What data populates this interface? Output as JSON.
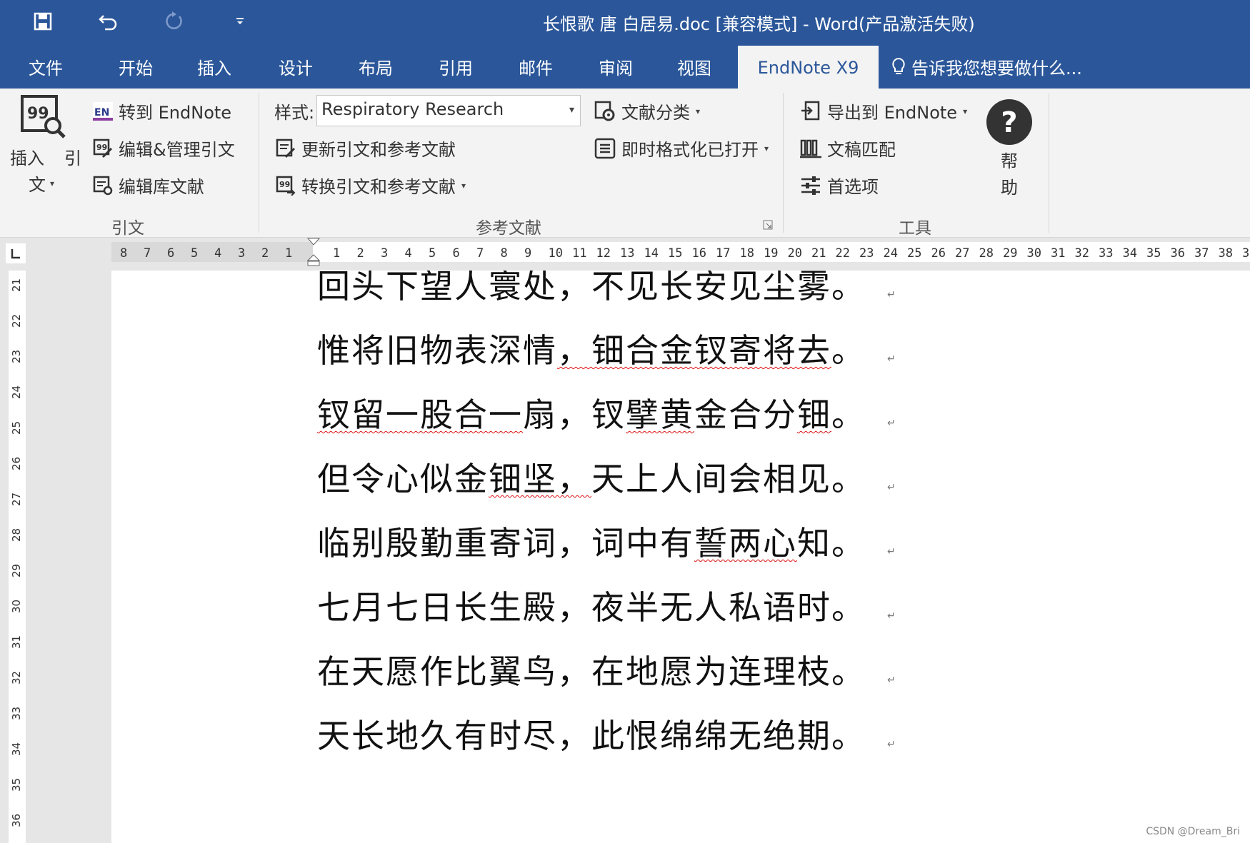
{
  "titlebar": {
    "title": "长恨歌 唐 白居易.doc [兼容模式] - Word(产品激活失败)",
    "quick_access": [
      "save-icon",
      "undo-icon",
      "redo-icon",
      "customize-icon"
    ]
  },
  "tabs": {
    "items": [
      "文件",
      "开始",
      "插入",
      "设计",
      "布局",
      "引用",
      "邮件",
      "审阅",
      "视图"
    ],
    "active": "EndNote X9",
    "tell_me": "告诉我您想要做什么..."
  },
  "ribbon": {
    "citations": {
      "insert_label": "插入",
      "insert_label2": "引",
      "insert_label3": "文",
      "goto_endnote": "转到 EndNote",
      "edit_manage": "编辑&管理引文",
      "edit_library": "编辑库文献",
      "group": "引文"
    },
    "bibliography": {
      "style_label": "样式:",
      "style_value": "Respiratory Research",
      "update": "更新引文和参考文献",
      "convert": "转换引文和参考文献",
      "categorize": "文献分类",
      "instant_format": "即时格式化已打开",
      "group": "参考文献"
    },
    "tools": {
      "export": "导出到 EndNote",
      "manuscript": "文稿匹配",
      "preferences": "首选项",
      "help_1": "帮",
      "help_2": "助",
      "group": "工具"
    }
  },
  "ruler": {
    "left_ticks": [
      "8",
      "7",
      "6",
      "5",
      "4",
      "3",
      "2",
      "1"
    ],
    "right_ticks": [
      "1",
      "2",
      "3",
      "4",
      "5",
      "6",
      "7",
      "8",
      "9",
      "10",
      "11",
      "12",
      "13",
      "14",
      "15",
      "16",
      "17",
      "18",
      "19",
      "20",
      "21",
      "22",
      "23",
      "24",
      "25",
      "26",
      "27",
      "28",
      "29",
      "30",
      "31",
      "32",
      "33",
      "34",
      "35",
      "36",
      "37",
      "38",
      "3"
    ],
    "vertical_ticks": [
      "21",
      "22",
      "23",
      "24",
      "25",
      "26",
      "27",
      "28",
      "29",
      "30",
      "31",
      "32",
      "33",
      "34",
      "35",
      "36"
    ]
  },
  "document": {
    "lines": [
      "回头下望人寰处，不见长安见尘雾。",
      "惟将旧物表深情，钿合金钗寄将去。",
      "钗留一股合一扇，钗擘黄金合分钿。",
      "但令心似金钿坚，天上人间会相见。",
      "临别殷勤重寄词，词中有誓两心知。",
      "七月七日长生殿，夜半无人私语时。",
      "在天愿作比翼鸟，在地愿为连理枝。",
      "天长地久有时尽，此恨绵绵无绝期。"
    ],
    "paragraph_mark": "↵"
  },
  "watermark": "CSDN @Dream_Bri",
  "colors": {
    "brand": "#2b579a",
    "ribbon_bg": "#f3f3f3"
  }
}
